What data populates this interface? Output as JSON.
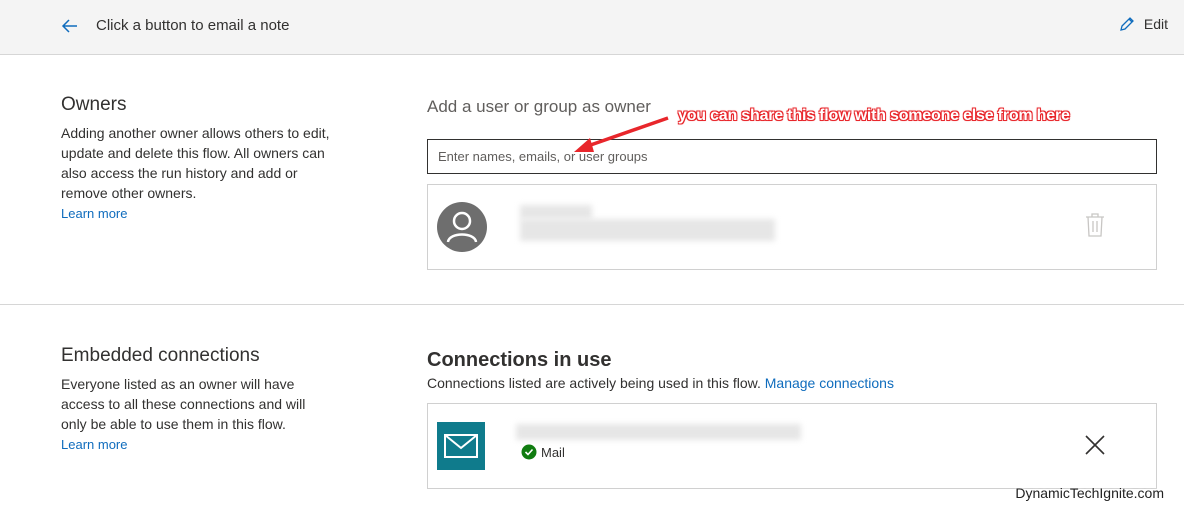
{
  "header": {
    "title": "Click a button to email a note",
    "edit_label": "Edit"
  },
  "owners": {
    "title": "Owners",
    "description": "Adding another owner allows others to edit, update and delete this flow. All owners can also access the run history and add or remove other owners.",
    "learn_more": "Learn more",
    "add_heading": "Add a user or group as owner",
    "input_placeholder": "Enter names, emails, or user groups",
    "input_value": ""
  },
  "embedded": {
    "title": "Embedded connections",
    "description": "Everyone listed as an owner will have access to all these connections and will only be able to use them in this flow.",
    "learn_more": "Learn more"
  },
  "connections": {
    "title": "Connections in use",
    "description": "Connections listed are actively being used in this flow.",
    "manage_link": "Manage connections",
    "items": [
      {
        "service": "Mail",
        "icon": "mail-icon",
        "status_icon": "check-circle-icon"
      }
    ]
  },
  "annotation": {
    "text": "you can share this flow with someone else from here",
    "color": "#e8262b"
  },
  "watermark": "DynamicTechIgnite.com",
  "colors": {
    "accent": "#0f6cbd",
    "mail_tile": "#0f7b8c",
    "success": "#107c10"
  }
}
